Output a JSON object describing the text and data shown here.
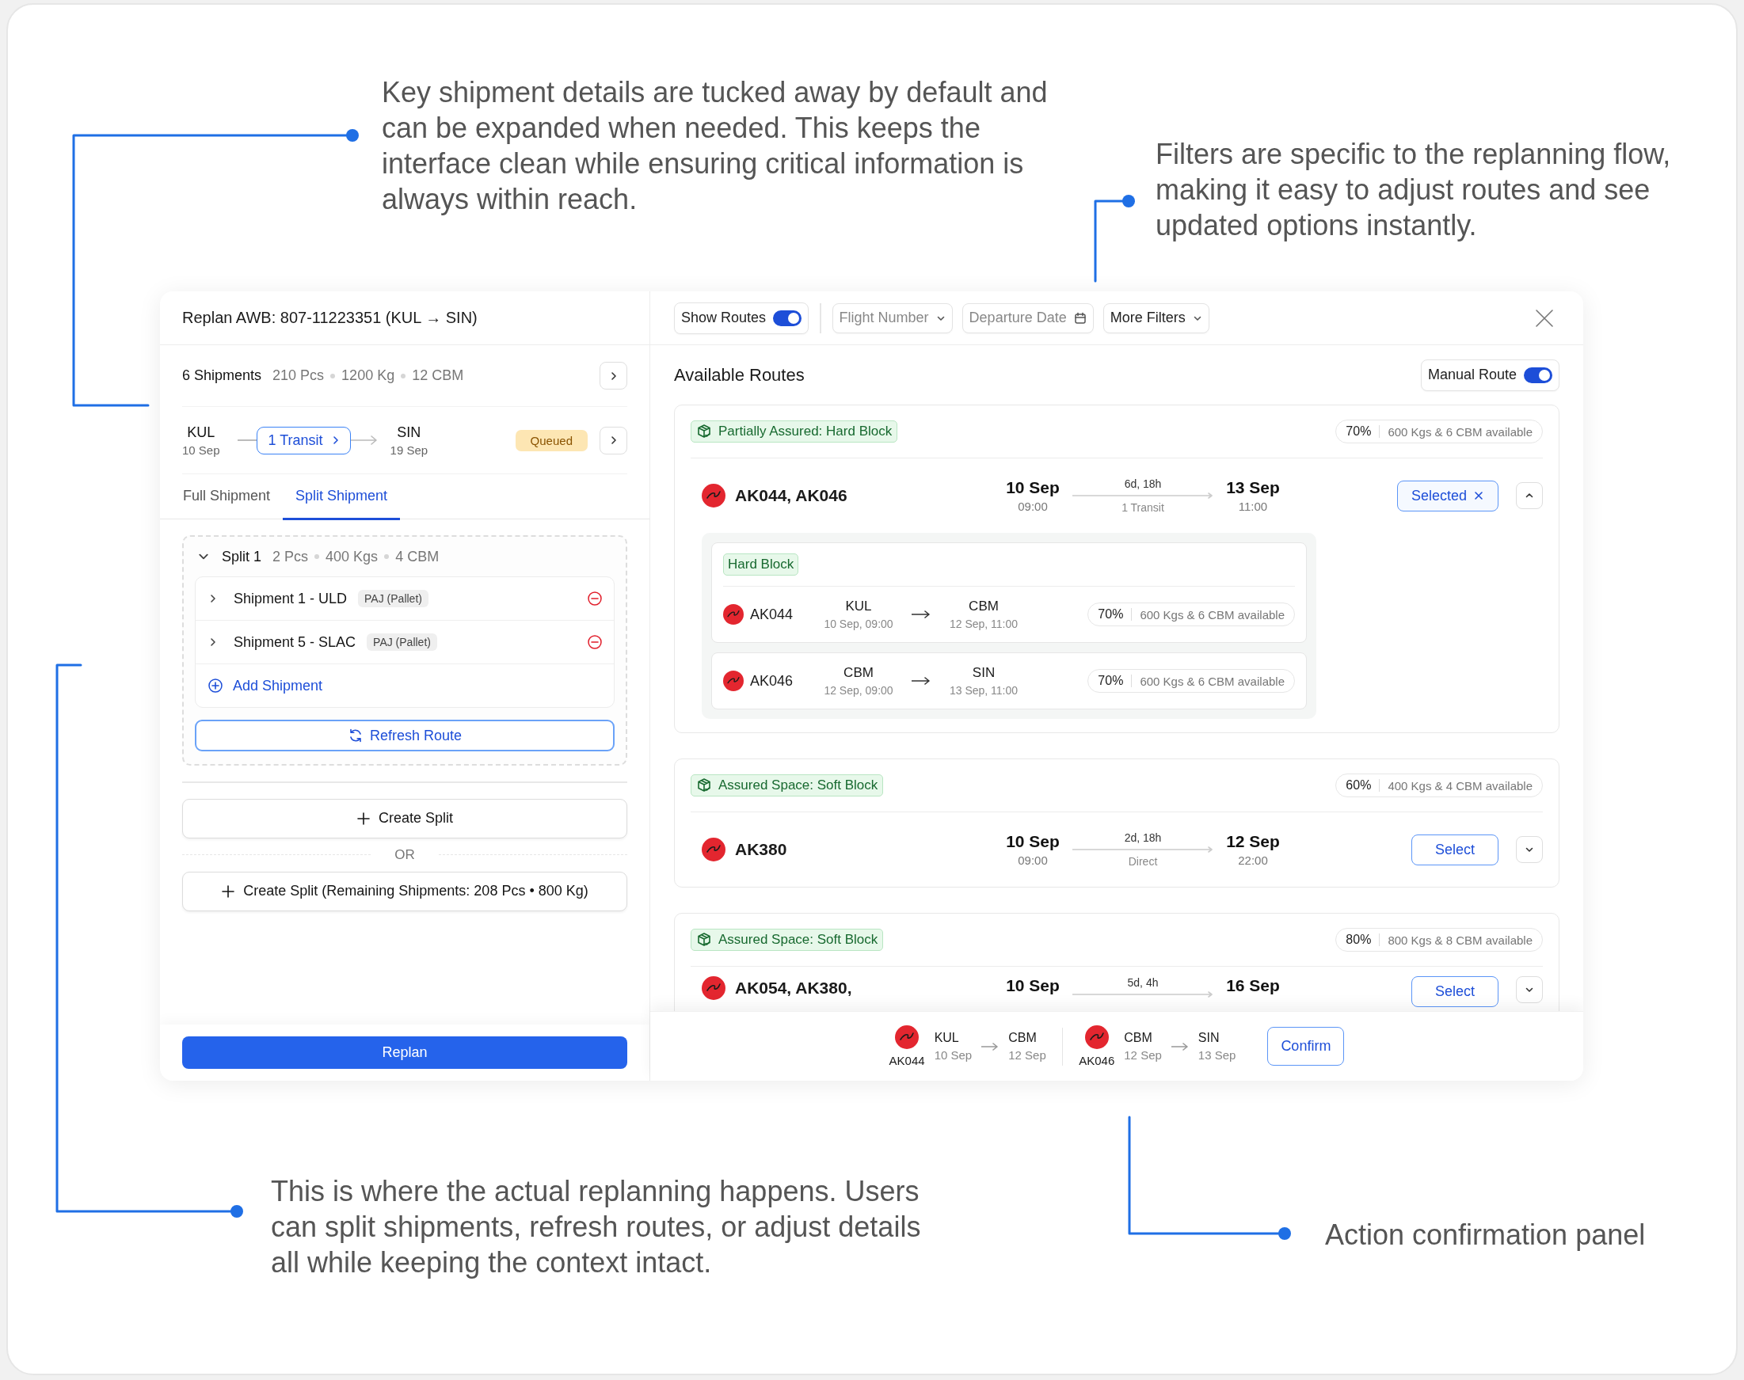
{
  "annotations": [
    {
      "text": "Key shipment details are tucked away by default and can be expanded when needed. This keeps the interface clean while ensuring critical information is always within reach."
    },
    {
      "text": "Filters are specific to the replanning flow, making it easy to adjust routes and see updated options instantly."
    },
    {
      "text": "This is where the actual replanning happens. Users can split shipments, refresh routes, or adjust details all while keeping the context intact."
    },
    {
      "text": "Action confirmation panel"
    }
  ],
  "replan": {
    "title": "Replan AWB: 807-11223351 (KUL → SIN)",
    "summary": {
      "count": "6 Shipments",
      "stats": [
        "210 Pcs",
        "1200 Kg",
        "12 CBM"
      ]
    },
    "route": {
      "origin": {
        "code": "KUL",
        "date": "10 Sep"
      },
      "transit": "1 Transit",
      "destination": {
        "code": "SIN",
        "date": "19 Sep"
      },
      "status": "Queued"
    },
    "tabs": [
      {
        "label": "Full Shipment",
        "selected": false
      },
      {
        "label": "Split Shipment",
        "selected": true
      }
    ],
    "splits": [
      {
        "title": "Split 1",
        "expanded": true,
        "stats": [
          "2 Pcs",
          "400 Kgs",
          "4 CBM"
        ],
        "shipments": [
          {
            "name": "Shipment 1 - ULD",
            "tag": "PAJ (Pallet)"
          },
          {
            "name": "Shipment 5 - SLAC",
            "tag": "PAJ (Pallet)"
          }
        ],
        "add_label": "Add Shipment",
        "refresh_label": "Refresh Route"
      }
    ],
    "create_split": "Create Split",
    "separator": "OR",
    "create_remaining": "Create Split (Remaining Shipments: 208 Pcs • 800 Kg)",
    "replan_button": "Replan"
  },
  "routes_panel": {
    "filters": [
      {
        "kind": "toggle",
        "label": "Show Routes",
        "on": true
      },
      {
        "kind": "dropdown",
        "placeholder": "Flight Number"
      },
      {
        "kind": "date",
        "placeholder": "Departure Date"
      },
      {
        "kind": "dropdown",
        "label": "More Filters"
      }
    ],
    "heading": "Available Routes",
    "manual_route": {
      "label": "Manual Route",
      "on": true
    },
    "routes": [
      {
        "assurance": "Partially Assured: Hard Block",
        "percent": "70%",
        "capacity": "600 Kgs & 6 CBM available",
        "flights": "AK044, AK046",
        "departure": {
          "date": "10 Sep",
          "time": "09:00"
        },
        "duration": "6d, 18h",
        "stops": "1 Transit",
        "arrival": {
          "date": "13 Sep",
          "time": "11:00"
        },
        "action": "Selected",
        "selected": true,
        "expanded": true,
        "segments_block": "Hard Block",
        "segments": [
          {
            "flight": "AK044",
            "from": {
              "code": "KUL",
              "time": "10 Sep, 09:00"
            },
            "to": {
              "code": "CBM",
              "time": "12 Sep, 11:00"
            },
            "percent": "70%",
            "capacity": "600 Kgs & 6 CBM available"
          },
          {
            "flight": "AK046",
            "from": {
              "code": "CBM",
              "time": "12 Sep, 09:00"
            },
            "to": {
              "code": "SIN",
              "time": "13 Sep, 11:00"
            },
            "percent": "70%",
            "capacity": "600 Kgs & 6 CBM available"
          }
        ]
      },
      {
        "assurance": "Assured Space: Soft Block",
        "percent": "60%",
        "capacity": "400 Kgs & 4 CBM available",
        "flights": "AK380",
        "departure": {
          "date": "10 Sep",
          "time": "09:00"
        },
        "duration": "2d, 18h",
        "stops": "Direct",
        "arrival": {
          "date": "12 Sep",
          "time": "22:00"
        },
        "action": "Select",
        "selected": false,
        "expanded": false
      },
      {
        "assurance": "Assured Space: Soft Block",
        "percent": "80%",
        "capacity": "800 Kgs & 8 CBM available",
        "flights": "AK054, AK380,",
        "departure": {
          "date": "10 Sep"
        },
        "duration": "5d, 4h",
        "arrival": {
          "date": "16 Sep"
        },
        "action": "Select",
        "selected": false,
        "expanded": false
      }
    ],
    "confirm_bar": {
      "legs": [
        {
          "flight": "AK044",
          "from": {
            "code": "KUL",
            "date": "10 Sep"
          },
          "to": {
            "code": "CBM",
            "date": "12 Sep"
          }
        },
        {
          "flight": "AK046",
          "from": {
            "code": "CBM",
            "date": "12 Sep"
          },
          "to": {
            "code": "SIN",
            "date": "13 Sep"
          }
        }
      ],
      "button": "Confirm"
    }
  }
}
